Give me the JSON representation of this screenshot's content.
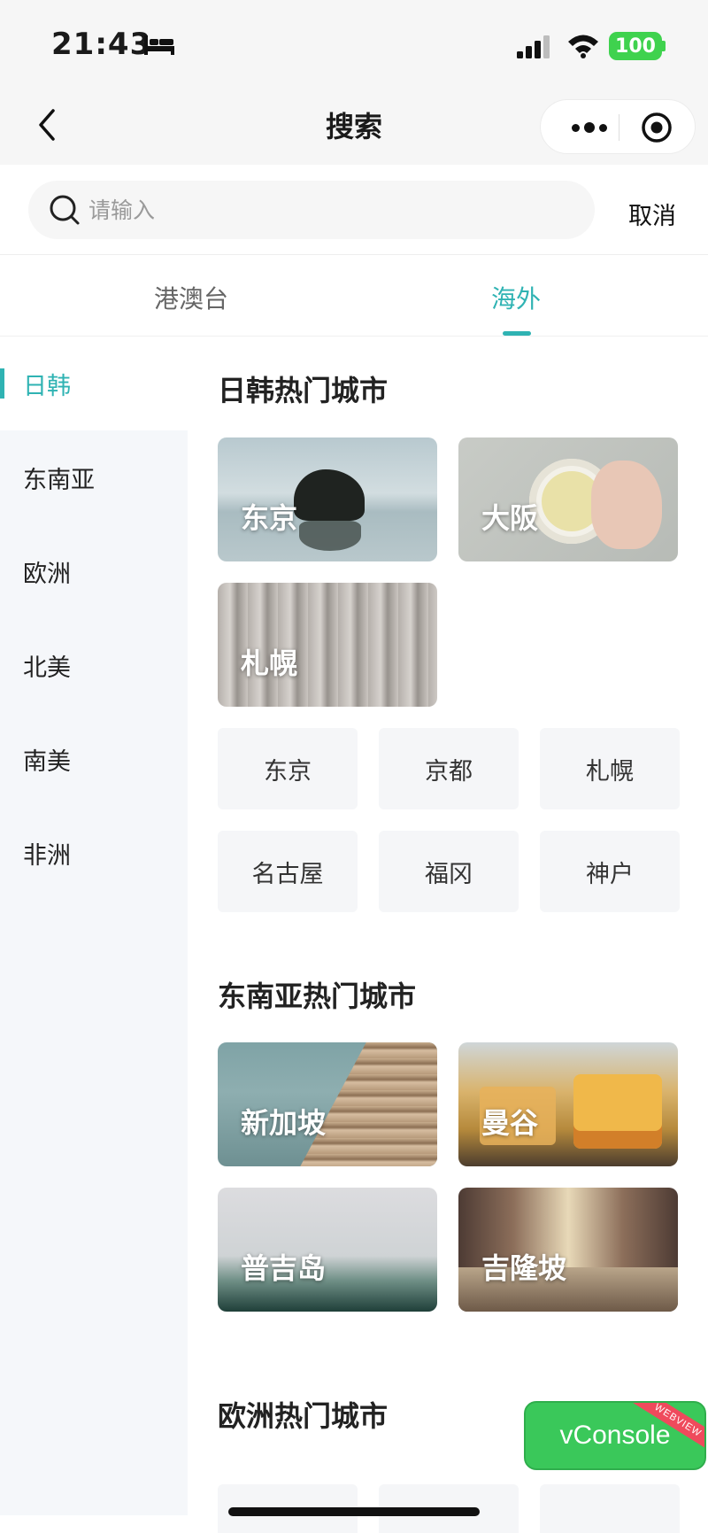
{
  "status_bar": {
    "time": "21:43",
    "battery": "100"
  },
  "nav": {
    "title": "搜索"
  },
  "search": {
    "placeholder": "请输入",
    "cancel_label": "取消"
  },
  "region_tabs": [
    {
      "label": "港澳台",
      "active": false
    },
    {
      "label": "海外",
      "active": true
    }
  ],
  "sidebar": {
    "items": [
      {
        "label": "日韩",
        "active": true
      },
      {
        "label": "东南亚",
        "active": false
      },
      {
        "label": "欧洲",
        "active": false
      },
      {
        "label": "北美",
        "active": false
      },
      {
        "label": "南美",
        "active": false
      },
      {
        "label": "非洲",
        "active": false
      }
    ]
  },
  "sections": [
    {
      "title": "日韩热门城市",
      "featured": [
        "东京",
        "大阪",
        "札幌"
      ],
      "cities": [
        "东京",
        "京都",
        "札幌",
        "名古屋",
        "福冈",
        "神户"
      ]
    },
    {
      "title": "东南亚热门城市",
      "featured": [
        "新加坡",
        "曼谷",
        "普吉岛",
        "吉隆坡"
      ]
    },
    {
      "title": "欧洲热门城市"
    }
  ],
  "vconsole": {
    "label": "vConsole",
    "ribbon": "WEBVIEW"
  },
  "colors": {
    "accent": "#2fb3b3",
    "sidebar_bg": "#f5f7fa",
    "chip_bg": "#f5f6f8",
    "vconsole": "#3ac85a"
  }
}
